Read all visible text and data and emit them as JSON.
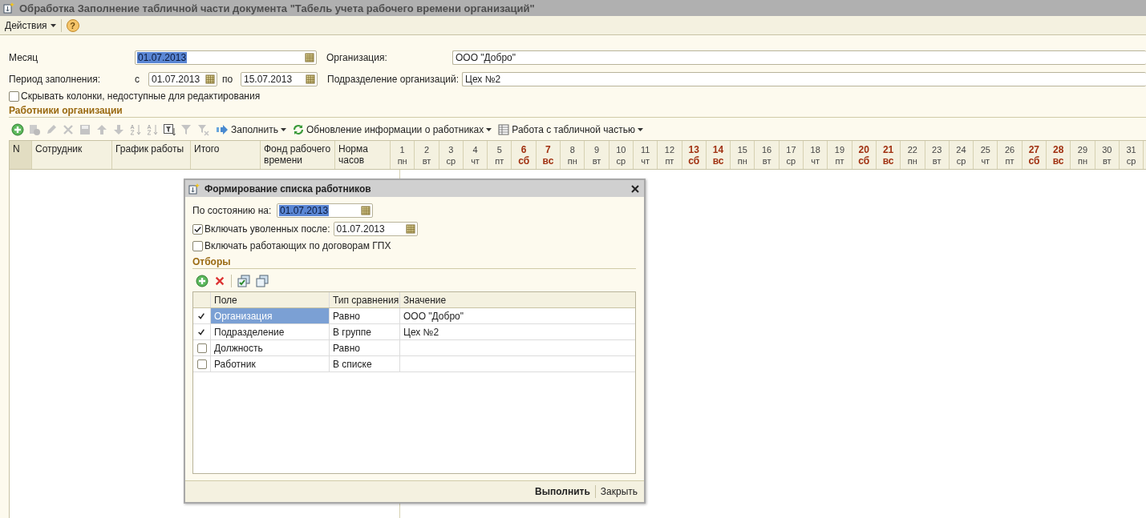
{
  "window": {
    "title": "Обработка  Заполнение табличной части документа \"Табель учета рабочего времени организаций\""
  },
  "menu": [
    {
      "kind": "menu",
      "label": "Действия"
    },
    {
      "kind": "help",
      "label": "?"
    }
  ],
  "form": {
    "month": {
      "label": "Месяц",
      "value": "01.07.2013",
      "highlighted": true
    },
    "period": {
      "label": "Период заполнения:",
      "from_label": "с",
      "from": "01.07.2013",
      "to_label": "по",
      "to": "15.07.2013"
    },
    "organization": {
      "label": "Организация:",
      "value": "ООО \"Добро\""
    },
    "division": {
      "label": "Подразделение организаций:",
      "value": "Цех №2"
    },
    "hide_columns": {
      "label": "Скрывать колонки, недоступные для редактирования",
      "checked": false
    }
  },
  "employees": {
    "title": "Работники организации",
    "toolbar": [
      {
        "kind": "icon",
        "disabled": false
      },
      {
        "kind": "icon",
        "disabled": true
      },
      {
        "kind": "icon",
        "disabled": true
      },
      {
        "kind": "icon",
        "disabled": true
      },
      {
        "kind": "icon",
        "disabled": true
      },
      {
        "kind": "icon",
        "disabled": true
      },
      {
        "kind": "icon",
        "disabled": true
      },
      {
        "kind": "icon",
        "disabled": true
      },
      {
        "kind": "icon",
        "disabled": true
      },
      {
        "kind": "icon",
        "disabled": false
      },
      {
        "kind": "icon",
        "disabled": true
      },
      {
        "kind": "icon",
        "disabled": true
      },
      {
        "kind": "menu",
        "label": "Заполнить"
      },
      {
        "kind": "menu",
        "label": "Обновление информации о работниках"
      },
      {
        "kind": "menu",
        "label": "Работа с табличной частью"
      }
    ],
    "columns": [
      "N",
      "Сотрудник",
      "График работы",
      "Итого",
      "Фонд рабочего времени",
      "Норма часов"
    ],
    "days": [
      {
        "day": "1",
        "weekday": "пн",
        "weekend": false
      },
      {
        "day": "2",
        "weekday": "вт",
        "weekend": false
      },
      {
        "day": "3",
        "weekday": "ср",
        "weekend": false
      },
      {
        "day": "4",
        "weekday": "чт",
        "weekend": false
      },
      {
        "day": "5",
        "weekday": "пт",
        "weekend": false
      },
      {
        "day": "6",
        "weekday": "сб",
        "weekend": true
      },
      {
        "day": "7",
        "weekday": "вс",
        "weekend": true
      },
      {
        "day": "8",
        "weekday": "пн",
        "weekend": false
      },
      {
        "day": "9",
        "weekday": "вт",
        "weekend": false
      },
      {
        "day": "10",
        "weekday": "ср",
        "weekend": false
      },
      {
        "day": "11",
        "weekday": "чт",
        "weekend": false
      },
      {
        "day": "12",
        "weekday": "пт",
        "weekend": false
      },
      {
        "day": "13",
        "weekday": "сб",
        "weekend": true
      },
      {
        "day": "14",
        "weekday": "вс",
        "weekend": true
      },
      {
        "day": "15",
        "weekday": "пн",
        "weekend": false
      },
      {
        "day": "16",
        "weekday": "вт",
        "weekend": false
      },
      {
        "day": "17",
        "weekday": "ср",
        "weekend": false
      },
      {
        "day": "18",
        "weekday": "чт",
        "weekend": false
      },
      {
        "day": "19",
        "weekday": "пт",
        "weekend": false
      },
      {
        "day": "20",
        "weekday": "сб",
        "weekend": true
      },
      {
        "day": "21",
        "weekday": "вс",
        "weekend": true
      },
      {
        "day": "22",
        "weekday": "пн",
        "weekend": false
      },
      {
        "day": "23",
        "weekday": "вт",
        "weekend": false
      },
      {
        "day": "24",
        "weekday": "ср",
        "weekend": false
      },
      {
        "day": "25",
        "weekday": "чт",
        "weekend": false
      },
      {
        "day": "26",
        "weekday": "пт",
        "weekend": false
      },
      {
        "day": "27",
        "weekday": "сб",
        "weekend": true
      },
      {
        "day": "28",
        "weekday": "вс",
        "weekend": true
      },
      {
        "day": "29",
        "weekday": "пн",
        "weekend": false
      },
      {
        "day": "30",
        "weekday": "вт",
        "weekend": false
      },
      {
        "day": "31",
        "weekday": "ср",
        "weekend": false
      }
    ]
  },
  "dialog": {
    "title": "Формирование списка работников",
    "as_of": {
      "label": "По состоянию на:",
      "value": "01.07.2013",
      "highlighted": true
    },
    "include_dismissed": {
      "label": "Включать уволенных после:",
      "checked": true,
      "value": "01.07.2013"
    },
    "include_gph": {
      "label": "Включать работающих по договорам ГПХ",
      "checked": false
    },
    "filters_title": "Отборы",
    "filter_toolbar": [
      {
        "kind": "add"
      },
      {
        "kind": "delete"
      },
      {
        "kind": "check_all"
      },
      {
        "kind": "uncheck_all"
      }
    ],
    "filter_columns": [
      "Поле",
      "Тип сравнения",
      "Значение"
    ],
    "filters": [
      {
        "checked": true,
        "field": "Организация",
        "comparison": "Равно",
        "value": "ООО \"Добро\"",
        "selected": true
      },
      {
        "checked": true,
        "field": "Подразделение",
        "comparison": "В группе",
        "value": "Цех №2",
        "selected": false
      },
      {
        "checked": false,
        "field": "Должность",
        "comparison": "Равно",
        "selected": false
      },
      {
        "checked": false,
        "field": "Работник",
        "comparison": "В списке",
        "selected": false
      }
    ],
    "buttons": [
      {
        "label": "Выполнить",
        "default": true
      },
      {
        "label": "Закрыть",
        "default": false
      }
    ]
  }
}
